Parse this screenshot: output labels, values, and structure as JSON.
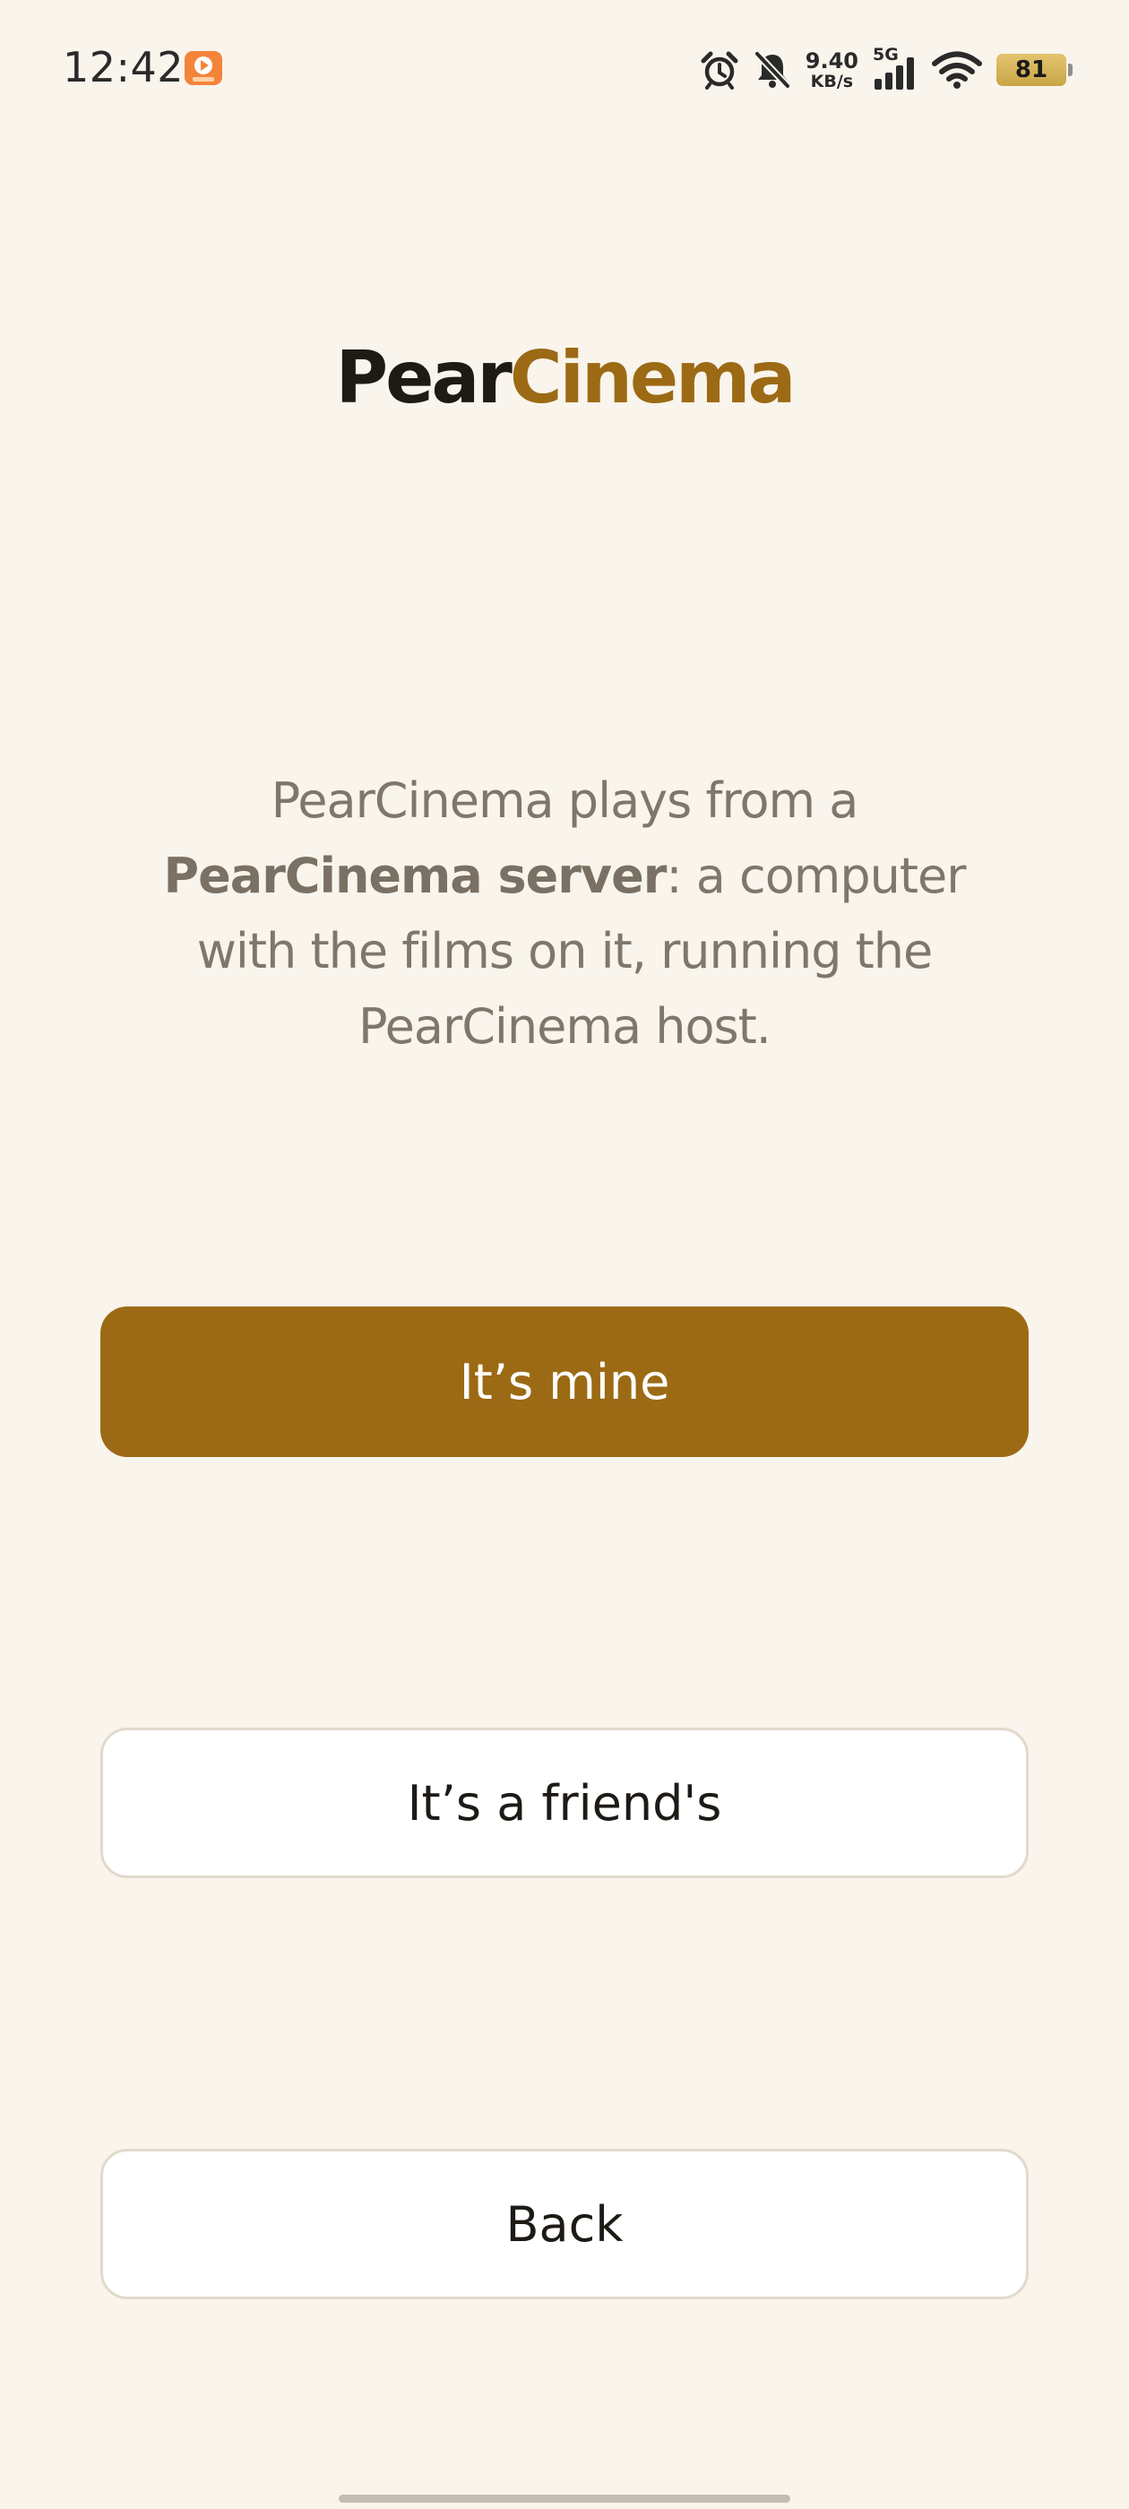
{
  "status_bar": {
    "time": "12:42",
    "net_speed_value": "9.40",
    "net_speed_unit": "KB/s",
    "network_type": "5G",
    "battery_level": "81",
    "icons": [
      "app-notification-icon",
      "alarm-icon",
      "silent-bell-icon",
      "signal-icon",
      "wifi-icon",
      "battery-icon"
    ]
  },
  "logo": {
    "part1": "Pear",
    "part2": "Cinema"
  },
  "intro": {
    "segment1": "PearCinema plays from a ",
    "segment2_bold": "PearCinema server",
    "segment3": ": a computer with the films on it, running the PearCinema host."
  },
  "buttons": {
    "mine": "It’s mine",
    "friend": "It’s a friend's",
    "back": "Back"
  },
  "colors": {
    "background": "#f9f4ec",
    "accent": "#9c6a14",
    "logo_dark": "#1e1a15",
    "body_text": "#7f776c",
    "button_border": "#e2d9cc"
  }
}
